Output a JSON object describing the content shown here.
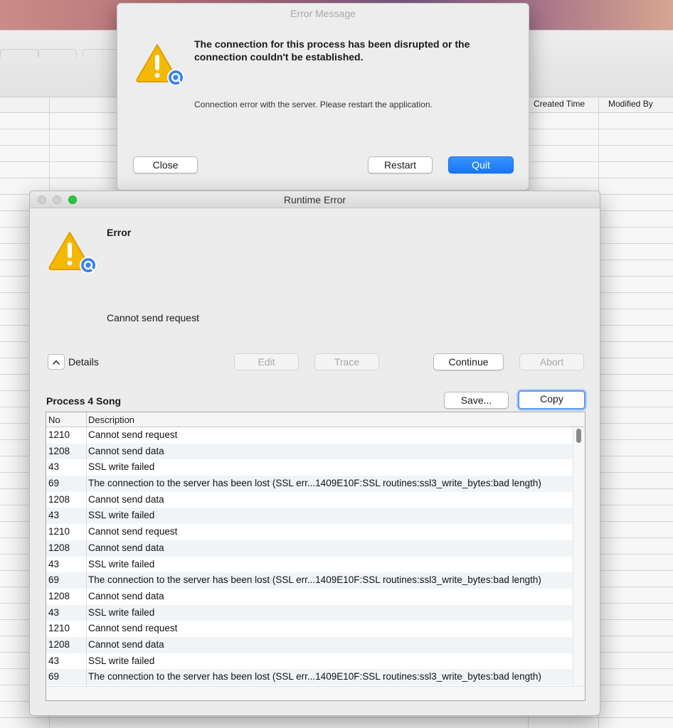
{
  "background_window": {
    "columns": [
      "Created Time",
      "Modified By"
    ]
  },
  "error_message_dialog": {
    "title": "Error Message",
    "heading": "The connection for this process has been disrupted or the connection couldn't be established.",
    "body": "Connection error with the server. Please restart the application.",
    "buttons": {
      "close": "Close",
      "restart": "Restart",
      "quit": "Quit"
    },
    "icon": "warning-icon"
  },
  "runtime_error_window": {
    "title": "Runtime Error",
    "heading": "Error",
    "message": "Cannot send request",
    "details_label": "Details",
    "buttons": {
      "edit": "Edit",
      "trace": "Trace",
      "continue": "Continue",
      "abort": "Abort",
      "save": "Save...",
      "copy": "Copy"
    },
    "process_label": "Process 4 Song",
    "table": {
      "headers": {
        "no": "No",
        "description": "Description"
      },
      "rows": [
        {
          "no": "1210",
          "description": "Cannot send request"
        },
        {
          "no": "1208",
          "description": "Cannot send data"
        },
        {
          "no": "43",
          "description": "SSL write failed"
        },
        {
          "no": "69",
          "description": "The connection to the server has been lost (SSL err...1409E10F:SSL routines:ssl3_write_bytes:bad length)"
        },
        {
          "no": "1208",
          "description": "Cannot send data"
        },
        {
          "no": "43",
          "description": "SSL write failed"
        },
        {
          "no": "1210",
          "description": "Cannot send request"
        },
        {
          "no": "1208",
          "description": "Cannot send data"
        },
        {
          "no": "43",
          "description": "SSL write failed"
        },
        {
          "no": "69",
          "description": "The connection to the server has been lost (SSL err...1409E10F:SSL routines:ssl3_write_bytes:bad length)"
        },
        {
          "no": "1208",
          "description": "Cannot send data"
        },
        {
          "no": "43",
          "description": "SSL write failed"
        },
        {
          "no": "1210",
          "description": "Cannot send request"
        },
        {
          "no": "1208",
          "description": "Cannot send data"
        },
        {
          "no": "43",
          "description": "SSL write failed"
        },
        {
          "no": "69",
          "description": "The connection to the server has been lost (SSL err...1409E10F:SSL routines:ssl3_write_bytes:bad length)"
        }
      ]
    }
  },
  "colors": {
    "primary_button": "#1677f5",
    "warning_yellow": "#f5b800",
    "badge_blue": "#3b82f6",
    "close_traffic": "#d0d0d0",
    "zoom_traffic": "#28c840"
  }
}
